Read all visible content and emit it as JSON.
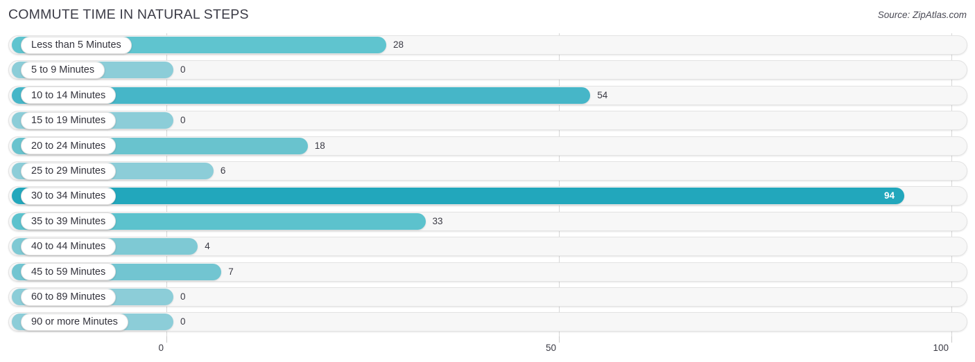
{
  "header": {
    "title": "COMMUTE TIME IN NATURAL STEPS",
    "source": "Source: ZipAtlas.com"
  },
  "chart_data": {
    "type": "bar",
    "orientation": "horizontal",
    "title": "COMMUTE TIME IN NATURAL STEPS",
    "subtitle": "Source: ZipAtlas.com",
    "xlabel": "",
    "ylabel": "",
    "xlim": [
      0,
      100
    ],
    "grid": true,
    "legend": null,
    "tick_labels": [
      "0",
      "50",
      "100"
    ],
    "ticks": [
      0,
      50,
      100
    ],
    "categories": [
      "Less than 5 Minutes",
      "5 to 9 Minutes",
      "10 to 14 Minutes",
      "15 to 19 Minutes",
      "20 to 24 Minutes",
      "25 to 29 Minutes",
      "30 to 34 Minutes",
      "35 to 39 Minutes",
      "40 to 44 Minutes",
      "45 to 59 Minutes",
      "60 to 89 Minutes",
      "90 or more Minutes"
    ],
    "values": [
      28,
      0,
      54,
      0,
      18,
      6,
      94,
      33,
      4,
      7,
      0,
      0
    ],
    "value_labels": [
      "28",
      "0",
      "54",
      "0",
      "18",
      "6",
      "94",
      "33",
      "4",
      "7",
      "0",
      "0"
    ],
    "bar_colors": [
      "#5fc4cf",
      "#8ccdd8",
      "#46b6c8",
      "#8ccdd8",
      "#69c3ce",
      "#8ccdd8",
      "#22a7bc",
      "#5cc2cd",
      "#7ec9d4",
      "#72c5d1",
      "#8ccdd8",
      "#8ccdd8"
    ],
    "label_inside": [
      false,
      false,
      false,
      false,
      false,
      false,
      true,
      false,
      false,
      false,
      false,
      false
    ]
  },
  "colors": {
    "accent": "#22a7bc",
    "track": "#f7f7f7",
    "gridline": "#d7d7d7",
    "text": "#33333c"
  }
}
